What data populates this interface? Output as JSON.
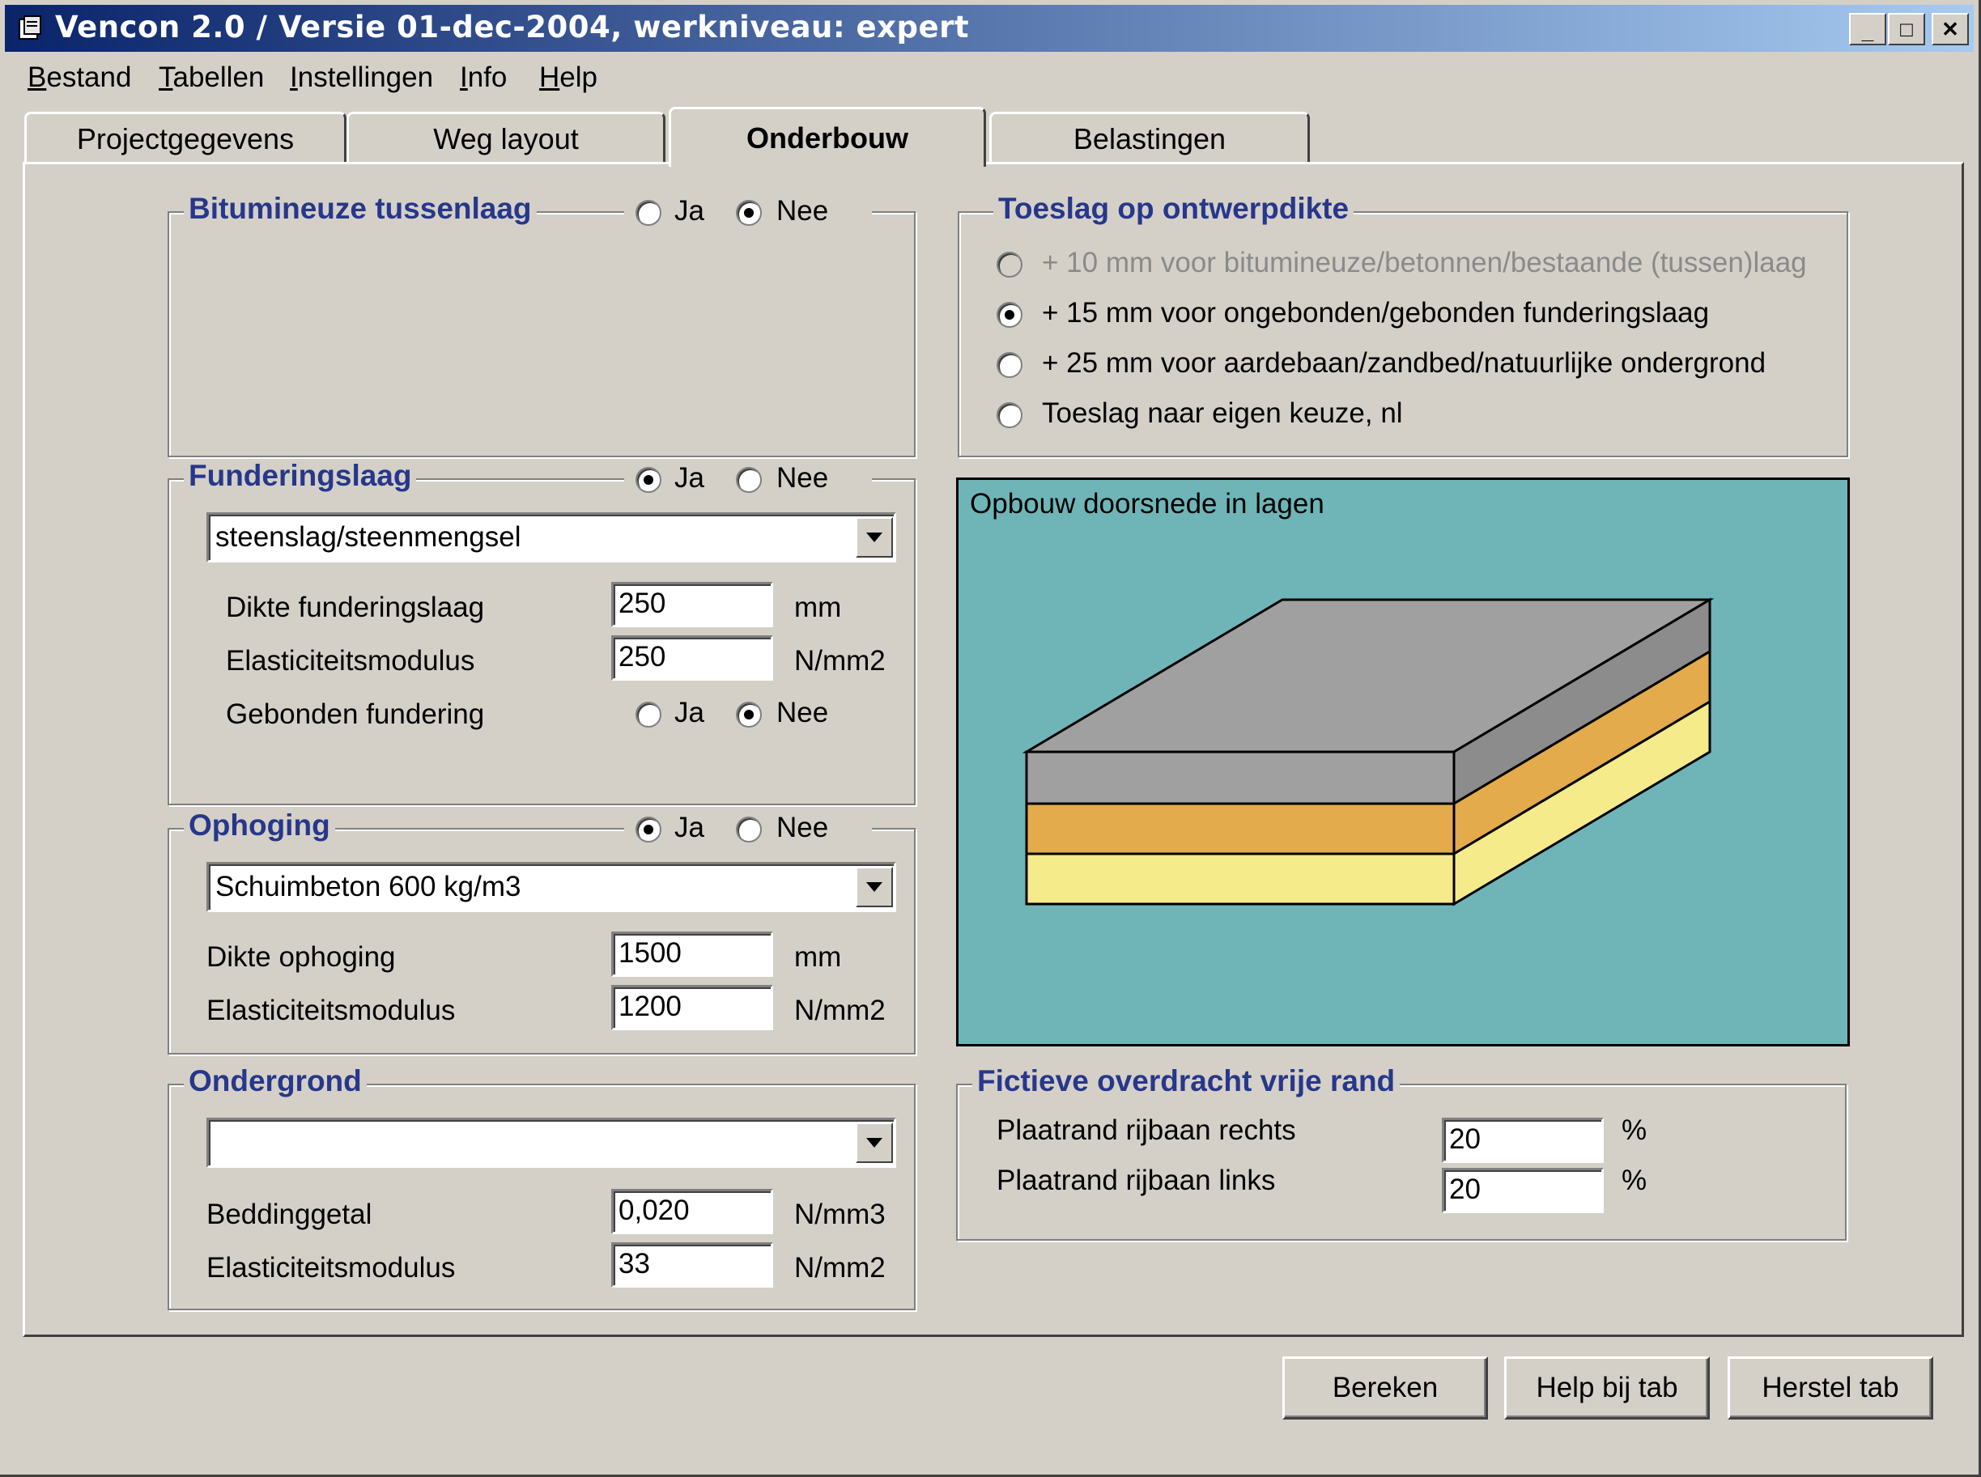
{
  "window": {
    "title": "Vencon 2.0 / Versie 01-dec-2004, werkniveau: expert",
    "minimize_glyph": "_",
    "maximize_glyph": "□",
    "close_glyph": "✕"
  },
  "menu": [
    "Bestand",
    "Tabellen",
    "Instellingen",
    "Info",
    "Help"
  ],
  "tabs": [
    "Projectgegevens",
    "Weg layout",
    "Onderbouw",
    "Belastingen"
  ],
  "active_tab": "Onderbouw",
  "bitumineuze": {
    "title": "Bitumineuze tussenlaag",
    "ja": "Ja",
    "nee": "Nee",
    "selected": "Nee"
  },
  "fundering": {
    "title": "Funderingslaag",
    "ja": "Ja",
    "nee": "Nee",
    "selected": "Ja",
    "material": "steenslag/steenmengsel",
    "dikte_label": "Dikte funderingslaag",
    "dikte_value": "250",
    "dikte_unit": "mm",
    "emod_label": "Elasticiteitsmodulus",
    "emod_value": "250",
    "emod_unit": "N/mm2",
    "gebonden_label": "Gebonden fundering",
    "gebonden_ja": "Ja",
    "gebonden_nee": "Nee",
    "gebonden_selected": "Nee"
  },
  "ophoging": {
    "title": "Ophoging",
    "ja": "Ja",
    "nee": "Nee",
    "selected": "Ja",
    "material": "Schuimbeton 600 kg/m3",
    "dikte_label": "Dikte ophoging",
    "dikte_value": "1500",
    "dikte_unit": "mm",
    "emod_label": "Elasticiteitsmodulus",
    "emod_value": "1200",
    "emod_unit": "N/mm2"
  },
  "ondergrond": {
    "title": "Ondergrond",
    "material": "",
    "bedding_label": "Beddinggetal",
    "bedding_value": "0,020",
    "bedding_unit": "N/mm3",
    "emod_label": "Elasticiteitsmodulus",
    "emod_value": "33",
    "emod_unit": "N/mm2"
  },
  "toeslag": {
    "title": "Toeslag op ontwerpdikte",
    "options": [
      "+ 10 mm voor bitumineuze/betonnen/bestaande (tussen)laag",
      "+ 15 mm voor ongebonden/gebonden funderingslaag",
      "+ 25 mm voor aardebaan/zandbed/natuurlijke ondergrond",
      "Toeslag naar eigen keuze, nl"
    ],
    "selected_index": 1,
    "disabled_index": 0
  },
  "opbouw": {
    "title": "Opbouw doorsnede in lagen",
    "background": "#6fb5b8",
    "layer_colors": [
      "#a0a0a0",
      "#e3ab4b",
      "#f6eb8b"
    ]
  },
  "overdracht": {
    "title": "Fictieve overdracht vrije rand",
    "rechts_label": "Plaatrand rijbaan rechts",
    "rechts_value": "20",
    "links_label": "Plaatrand rijbaan links",
    "links_value": "20",
    "unit": "%"
  },
  "buttons": {
    "bereken": "Bereken",
    "help": "Help bij tab",
    "herstel": "Herstel tab"
  },
  "colors": {
    "title_gradient_start": "#0a246a",
    "title_gradient_end": "#a6caf0",
    "group_title": "#27378a",
    "face": "#d4d0c8"
  }
}
